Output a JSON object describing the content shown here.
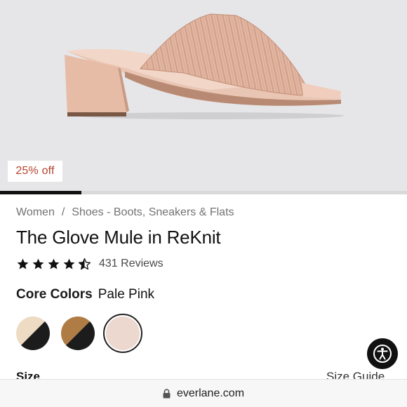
{
  "hero": {
    "image": "pale-pink-knit-block-heel-mule",
    "badge": "25% off",
    "gallery_progress": 0.2
  },
  "breadcrumb": {
    "items": [
      "Women",
      "Shoes - Boots, Sneakers & Flats"
    ],
    "separator": "/"
  },
  "product": {
    "title": "The Glove Mule in ReKnit",
    "rating": 4.5,
    "reviews_label": "431 Reviews"
  },
  "colors": {
    "group_label": "Core Colors",
    "selected": "Pale Pink",
    "swatches": [
      {
        "name": "cream-black",
        "colors": [
          "#eddcc3",
          "#1c1c1c"
        ]
      },
      {
        "name": "tan-black",
        "colors": [
          "#b07c45",
          "#1c1c1c"
        ]
      },
      {
        "name": "pale-pink",
        "colors": [
          "#ecd8cf"
        ],
        "selected": true
      }
    ]
  },
  "size": {
    "label": "Size",
    "guide_label": "Size Guide"
  },
  "browser": {
    "url": "everlane.com"
  },
  "theme": {
    "sale_color": "#b5442b",
    "text_color": "#111111",
    "muted_text": "#737373"
  }
}
